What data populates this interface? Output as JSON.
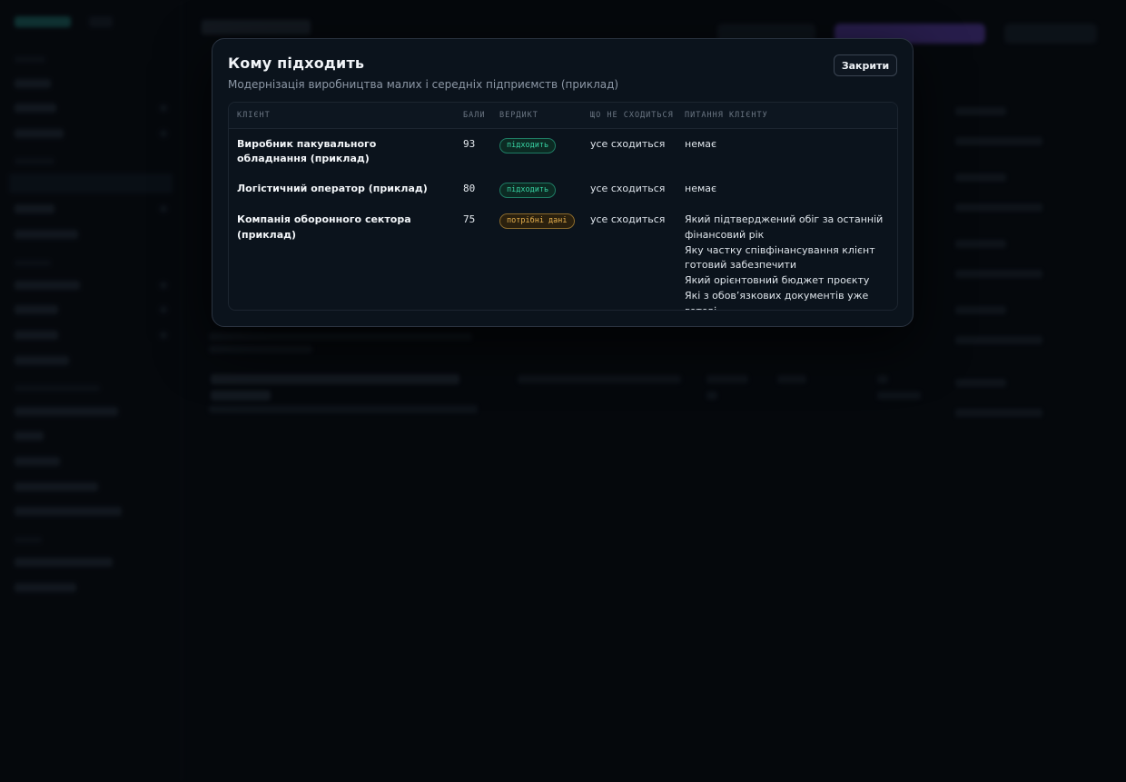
{
  "modal": {
    "title": "Кому підходить",
    "subtitle": "Модернізація виробництва малих і середніх підприємств (приклад)",
    "close_label": "Закрити"
  },
  "table": {
    "headers": {
      "client": "КЛІЄНТ",
      "score": "БАЛИ",
      "verdict": "ВЕРДИКТ",
      "mismatch": "ЩО НЕ СХОДИТЬСЯ",
      "questions": "ПИТАННЯ КЛІЄНТУ"
    },
    "rows": [
      {
        "client": "Виробник пакувального обладнання (приклад)",
        "score": "93",
        "verdict": "підходить",
        "verdict_kind": "fit",
        "mismatch": "усе сходиться",
        "questions": [
          "немає"
        ]
      },
      {
        "client": "Логістичний оператор (приклад)",
        "score": "80",
        "verdict": "підходить",
        "verdict_kind": "fit",
        "mismatch": "усе сходиться",
        "questions": [
          "немає"
        ]
      },
      {
        "client": "Компанія оборонного сектора (приклад)",
        "score": "75",
        "verdict": "потрібні дані",
        "verdict_kind": "data",
        "mismatch": "усе сходиться",
        "questions": [
          "Який підтверджений обіг за останній фінансовий рік",
          "Яку частку співфінансування клієнт готовий забезпечити",
          "Який орієнтовний бюджет проєкту",
          "Які з обов’язкових документів уже готові"
        ]
      }
    ]
  },
  "colors": {
    "fit_badge": "#37d3a3",
    "data_badge": "#e9b24f",
    "modal_bg": "#0b131c"
  }
}
